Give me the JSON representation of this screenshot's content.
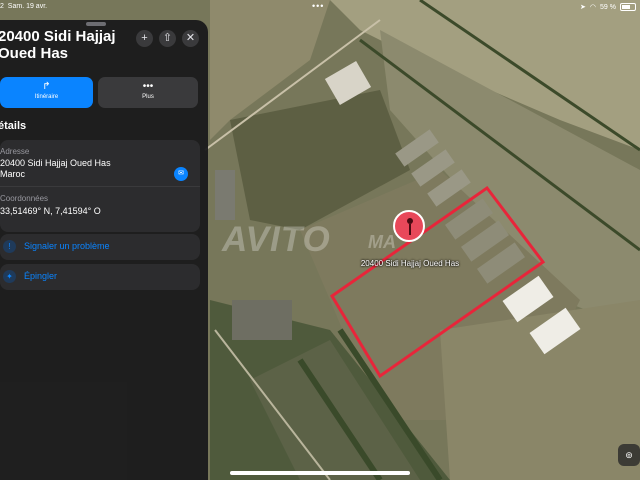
{
  "status_bar": {
    "time": "2",
    "date": "Sam. 19 avr.",
    "battery": "59 %"
  },
  "place": {
    "title": "20400 Sidi Hajjaj Oued Has",
    "pin_label": "20400 Sidi Hajjaj Oued Has"
  },
  "header_buttons": [
    {
      "icon": "plus-icon",
      "glyph": "+"
    },
    {
      "icon": "share-icon",
      "glyph": "⇧"
    },
    {
      "icon": "close-icon",
      "glyph": "✕"
    }
  ],
  "actions": {
    "itineraire": {
      "label": "Itinéraire",
      "icon": "directions-icon",
      "glyph": "↱",
      "color": "#0a84ff"
    },
    "plus": {
      "label": "Plus",
      "icon": "more-icon",
      "glyph": "•••"
    }
  },
  "details": {
    "section_title": "étails",
    "address_label": "Adresse",
    "address_line1": "20400 Sidi Hajjaj Oued Has",
    "address_line2": "Maroc",
    "coords_label": "Coordonnées",
    "coords_value": "33,51469° N, 7,41594° O"
  },
  "links": {
    "report": {
      "label": "Signaler un problème",
      "icon": "report-icon",
      "glyph": "!"
    },
    "pin": {
      "label": "Épingler",
      "icon": "pin-icon",
      "glyph": "✦"
    }
  },
  "watermark": {
    "brand": "AVITO",
    "suffix": "MA"
  },
  "colors": {
    "accent": "#0a84ff",
    "pin": "#e8485a",
    "boundary": "#e8253a",
    "panel": "#18181a"
  }
}
